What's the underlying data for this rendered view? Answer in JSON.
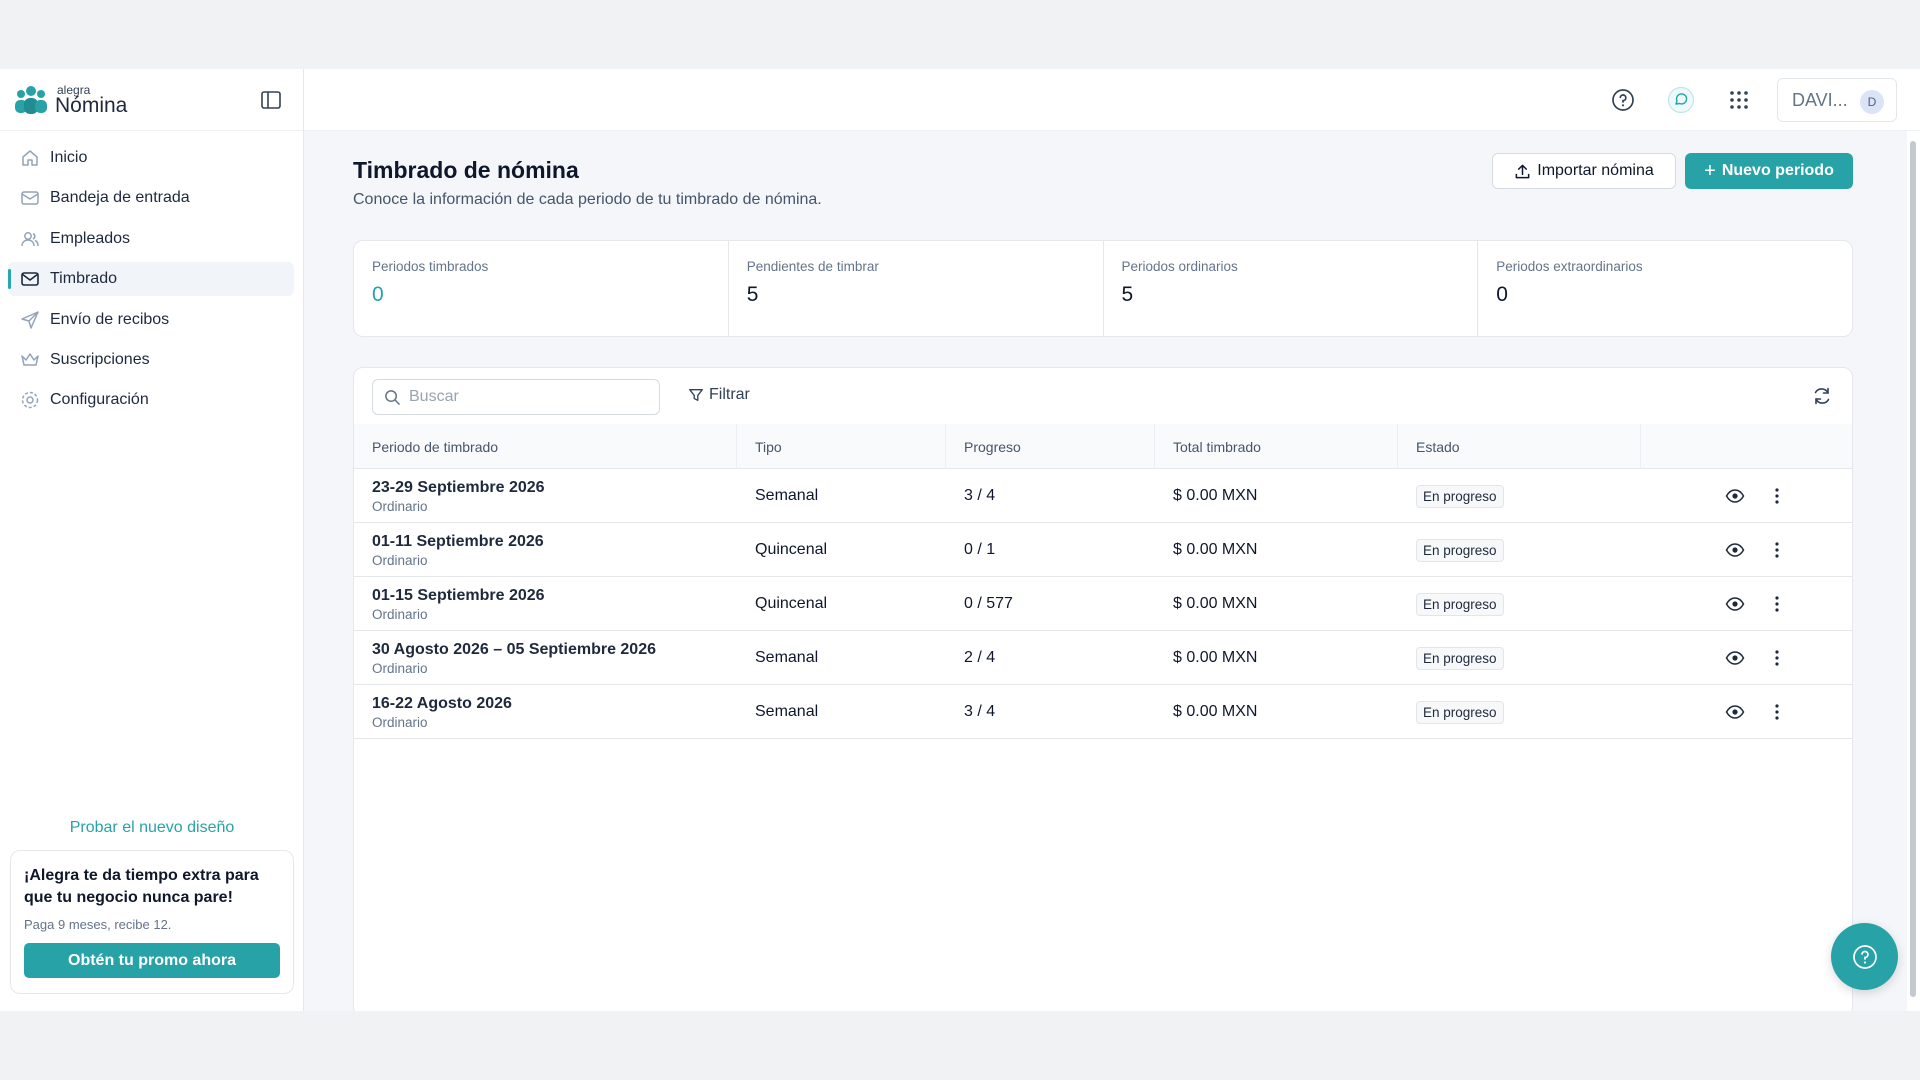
{
  "brand": {
    "small": "alegra",
    "name": "Nómina",
    "accent": "#27a3a8"
  },
  "sidebar": {
    "items": [
      {
        "label": "Inicio",
        "icon": "home-icon"
      },
      {
        "label": "Bandeja de entrada",
        "icon": "inbox-icon"
      },
      {
        "label": "Empleados",
        "icon": "users-icon"
      },
      {
        "label": "Timbrado",
        "icon": "mail-icon",
        "active": true
      },
      {
        "label": "Envío de recibos",
        "icon": "send-icon"
      },
      {
        "label": "Suscripciones",
        "icon": "crown-icon"
      },
      {
        "label": "Configuración",
        "icon": "gear-icon"
      }
    ],
    "try_link": "Probar el nuevo diseño",
    "promo": {
      "title": "¡Alegra te da tiempo extra para que tu negocio nunca pare!",
      "subtitle": "Paga 9 meses, recibe 12.",
      "button": "Obtén tu promo ahora"
    }
  },
  "topbar": {
    "user_name": "DAVI...",
    "avatar_initial": "D"
  },
  "page": {
    "title": "Timbrado de nómina",
    "subtitle": "Conoce la información de cada periodo de tu timbrado de nómina.",
    "import_button": "Importar nómina",
    "new_button": "Nuevo periodo"
  },
  "stats": [
    {
      "label": "Periodos timbrados",
      "value": "0"
    },
    {
      "label": "Pendientes de timbrar",
      "value": "5"
    },
    {
      "label": "Periodos ordinarios",
      "value": "5"
    },
    {
      "label": "Periodos extraordinarios",
      "value": "0"
    }
  ],
  "table": {
    "search_placeholder": "Buscar",
    "filter_label": "Filtrar",
    "columns": [
      "Periodo de timbrado",
      "Tipo",
      "Progreso",
      "Total timbrado",
      "Estado"
    ],
    "rows": [
      {
        "period": "23-29 Septiembre 2026",
        "kind": "Ordinario",
        "type": "Semanal",
        "progress": "3 / 4",
        "total": "$ 0.00 MXN",
        "status": "En progreso"
      },
      {
        "period": "01-11 Septiembre 2026",
        "kind": "Ordinario",
        "type": "Quincenal",
        "progress": "0 / 1",
        "total": "$ 0.00 MXN",
        "status": "En progreso"
      },
      {
        "period": "01-15 Septiembre 2026",
        "kind": "Ordinario",
        "type": "Quincenal",
        "progress": "0 / 577",
        "total": "$ 0.00 MXN",
        "status": "En progreso"
      },
      {
        "period": "30 Agosto 2026 – 05 Septiembre 2026",
        "kind": "Ordinario",
        "type": "Semanal",
        "progress": "2 / 4",
        "total": "$ 0.00 MXN",
        "status": "En progreso"
      },
      {
        "period": "16-22 Agosto 2026",
        "kind": "Ordinario",
        "type": "Semanal",
        "progress": "3 / 4",
        "total": "$ 0.00 MXN",
        "status": "En progreso"
      }
    ]
  }
}
